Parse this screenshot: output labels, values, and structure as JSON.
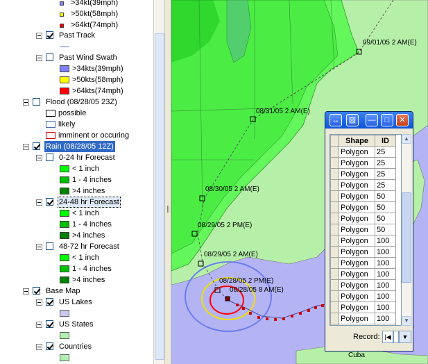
{
  "toc": {
    "items": [
      {
        "type": "swatch",
        "label": ">34kt(39mph)",
        "color": "#8080ff",
        "x": 88,
        "y": 0,
        "small": true
      },
      {
        "type": "swatch",
        "label": ">50kt(58mph)",
        "color": "#ffff00",
        "x": 88,
        "y": 17,
        "small": true
      },
      {
        "type": "swatch",
        "label": ">64kt(74mph)",
        "color": "#ff0000",
        "x": 88,
        "y": 34,
        "small": true
      }
    ],
    "past_track": "Past Track",
    "past_wind_swath": "Past Wind Swath",
    "swath_34": ">34kts(39mph)",
    "swath_50": ">50kts(58mph)",
    "swath_64": ">64kts(74mph)",
    "flood": "Flood (08/28/05  23Z)",
    "possible": "possible",
    "likely": "likely",
    "imminent": "imminent or occuring",
    "rain": "Rain (08/28/05 12Z)",
    "f0_24": "0-24 hr Forecast",
    "f24_48": "24-48 hr Forecast",
    "f48_72": "48-72 hr Forecast",
    "lt1": "< 1 inch",
    "b1_4": "1 - 4 inches",
    "gt4": ">4 inches",
    "base_map": "Base Map",
    "us_lakes": "US Lakes",
    "us_states": "US States",
    "countries": "Countries",
    "top_34": ">34kt(39mph)",
    "top_50": ">50kt(58mph)",
    "top_64": ">64kt(74mph)"
  },
  "map": {
    "labels": {
      "l1": "09/01/05 2 AM(E)",
      "l2": "08/31/05 2 AM(E)",
      "l3": "08/30/05 2 AM(E)",
      "l4": "08/29/05 2 PM(E)",
      "l5": "08/29/05 2 AM(E)",
      "l6": "08/28/05 2 PM(E)",
      "l7": "08/28/05 8 AM(E)",
      "cuba": "Cuba"
    }
  },
  "attr_window": {
    "headers": [
      "Shape",
      "ID"
    ],
    "rows": [
      [
        "Polygon",
        "25"
      ],
      [
        "Polygon",
        "25"
      ],
      [
        "Polygon",
        "25"
      ],
      [
        "Polygon",
        "25"
      ],
      [
        "Polygon",
        "50"
      ],
      [
        "Polygon",
        "50"
      ],
      [
        "Polygon",
        "50"
      ],
      [
        "Polygon",
        "50"
      ],
      [
        "Polygon",
        "100"
      ],
      [
        "Polygon",
        "100"
      ],
      [
        "Polygon",
        "100"
      ],
      [
        "Polygon",
        "100"
      ],
      [
        "Polygon",
        "100"
      ],
      [
        "Polygon",
        "100"
      ],
      [
        "Polygon",
        "100"
      ],
      [
        "Polygon",
        "100"
      ],
      [
        "Polygon",
        "100"
      ]
    ],
    "record_label": "Record:"
  }
}
